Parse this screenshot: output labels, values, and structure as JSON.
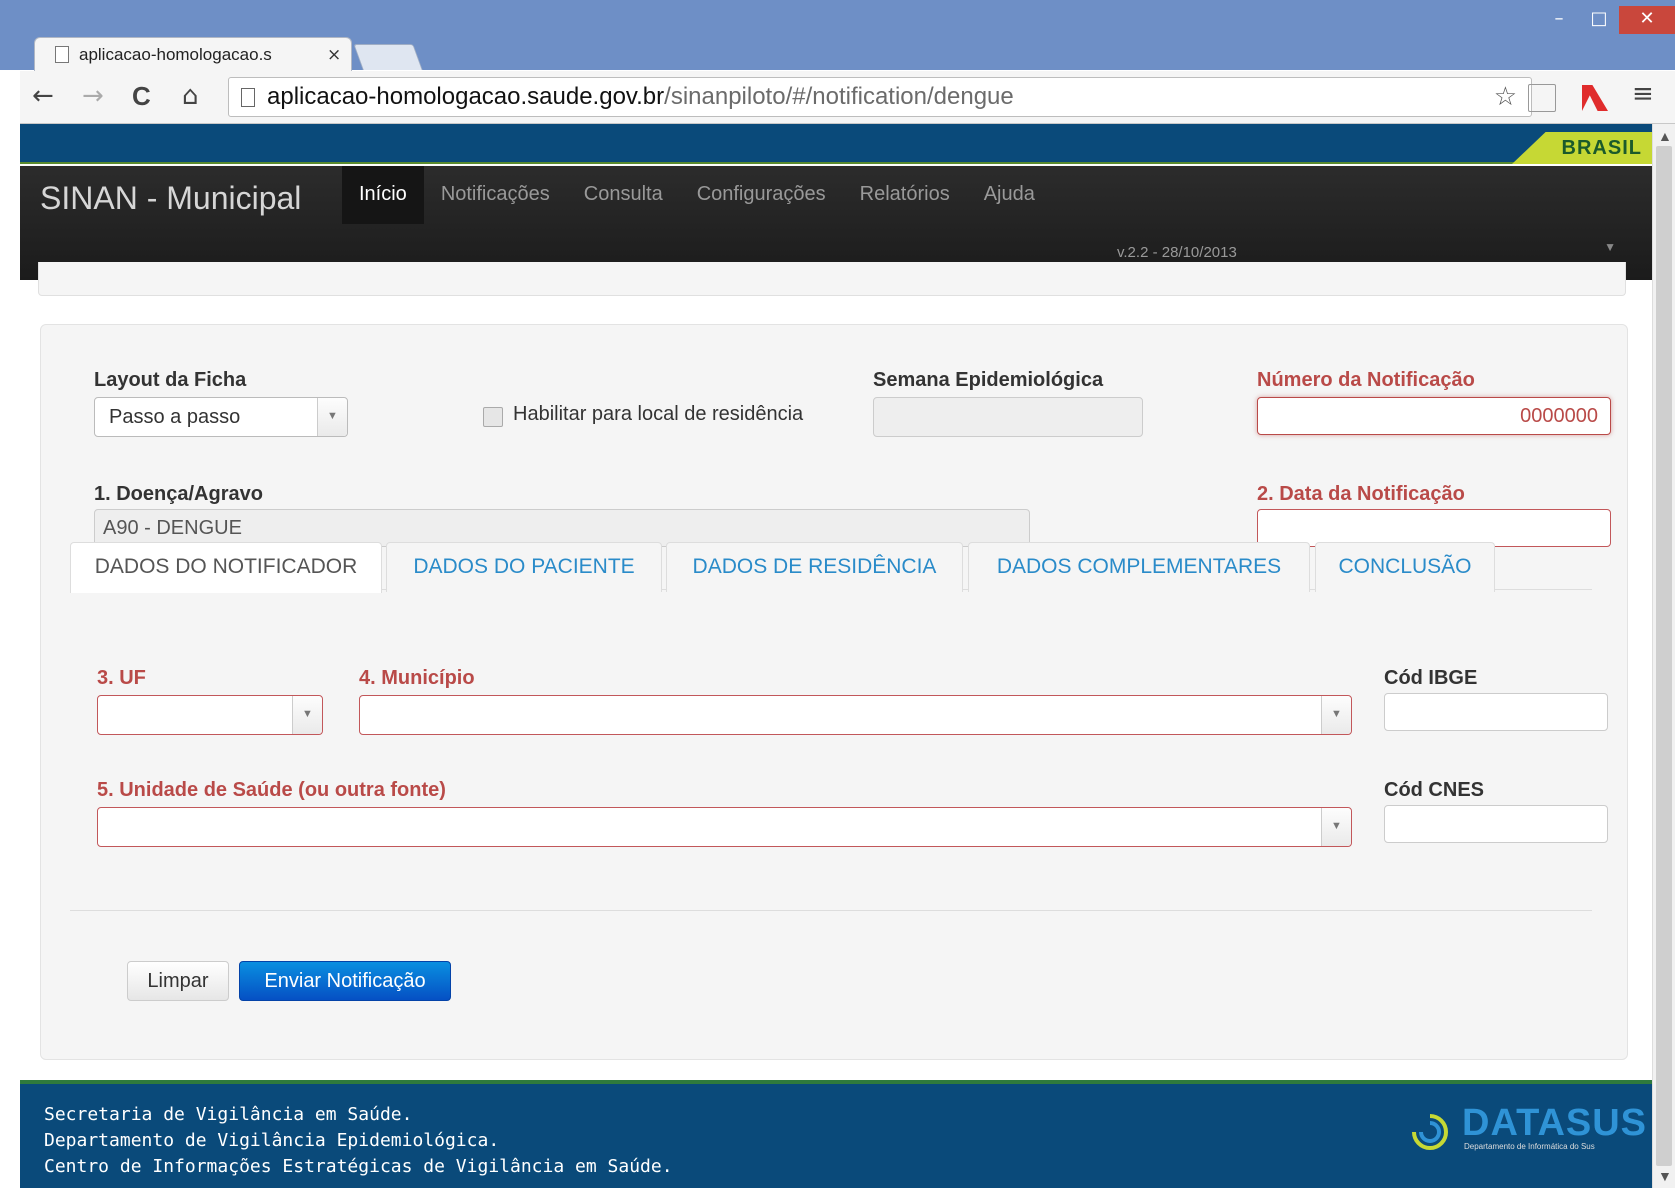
{
  "browser": {
    "tab_title": "aplicacao-homologacao.s",
    "tab_close": "×",
    "url_host": "aplicacao-homologacao.saude.gov.br",
    "url_path": "/sinanpiloto/#/notification/dengue",
    "win_min": "–",
    "win_max": "□",
    "win_close": "✕",
    "back_icon": "←",
    "forward_icon": "→",
    "reload_icon": "C",
    "home_icon": "⌂",
    "star_icon": "☆",
    "menu_icon": "≡"
  },
  "gov_banner": {
    "label": "BRASIL"
  },
  "app": {
    "brand": "SINAN - Municipal",
    "menu": [
      {
        "label": "Início",
        "active": true
      },
      {
        "label": "Notificações"
      },
      {
        "label": "Consulta"
      },
      {
        "label": "Configurações"
      },
      {
        "label": "Relatórios"
      },
      {
        "label": "Ajuda"
      }
    ],
    "version": "v.2.2 - 28/10/2013"
  },
  "form": {
    "layout_label": "Layout da Ficha",
    "layout_value": "Passo a passo",
    "residence_checkbox_label": "Habilitar para local de residência",
    "semana_label": "Semana Epidemiológica",
    "semana_value": "",
    "numero_label": "Número da Notificação",
    "numero_value": "0000000",
    "doenca_label": "1. Doença/Agravo",
    "doenca_value": "A90 - DENGUE",
    "data_label": "2. Data da Notificação",
    "data_value": "",
    "tabs": [
      {
        "label": "DADOS DO NOTIFICADOR",
        "active": true
      },
      {
        "label": "DADOS DO PACIENTE"
      },
      {
        "label": "DADOS DE RESIDÊNCIA"
      },
      {
        "label": "DADOS COMPLEMENTARES"
      },
      {
        "label": "CONCLUSÃO"
      }
    ],
    "uf_label": "3. UF",
    "municipio_label": "4. Município",
    "ibge_label": "Cód IBGE",
    "unidade_label": "5. Unidade de Saúde (ou outra fonte)",
    "cnes_label": "Cód CNES",
    "clear_button": "Limpar",
    "submit_button": "Enviar Notificação",
    "dropdown_arrow": "▼"
  },
  "footer": {
    "line1": "Secretaria de Vigilância em Saúde.",
    "line2": "Departamento de Vigilância Epidemiológica.",
    "line3": "Centro de Informações Estratégicas de Vigilância em Saúde.",
    "logo_word": "DATASUS",
    "logo_sub": "Departamento de Informática do Sus"
  },
  "colors": {
    "required": "#b94a48",
    "link": "#2a8bc9",
    "primary": "#0660d0",
    "gov_blue": "#0a4a7a"
  }
}
